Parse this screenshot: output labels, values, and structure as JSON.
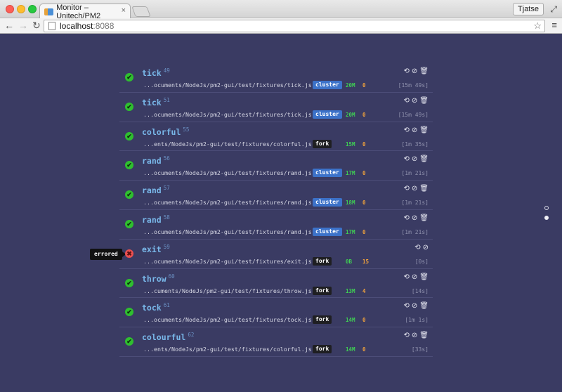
{
  "browser": {
    "tab_title": "Monitor – Unitech/PM2",
    "user": "Tjatse",
    "url_host": "localhost",
    "url_port": ":8088",
    "icons": [
      "back-icon",
      "forward-icon",
      "reload-icon",
      "star-icon",
      "menu-icon",
      "fullscreen-icon"
    ]
  },
  "tooltip": "errored",
  "processes": [
    {
      "name": "tick",
      "pid": "49",
      "script": "...ocuments/NodeJs/pm2-gui/test/fixtures/tick.js",
      "mode": "cluster",
      "memory": "20M",
      "restarts": "0",
      "uptime": "[15m 49s]",
      "status": "online",
      "status_icon": "✔"
    },
    {
      "name": "tick",
      "pid": "51",
      "script": "...ocuments/NodeJs/pm2-gui/test/fixtures/tick.js",
      "mode": "cluster",
      "memory": "20M",
      "restarts": "0",
      "uptime": "[15m 49s]",
      "status": "online",
      "status_icon": "✔"
    },
    {
      "name": "colorful",
      "pid": "55",
      "script": "...ents/NodeJs/pm2-gui/test/fixtures/colorful.js",
      "mode": "fork",
      "memory": "15M",
      "restarts": "0",
      "uptime": "[1m 35s]",
      "status": "online",
      "status_icon": "✔"
    },
    {
      "name": "rand",
      "pid": "56",
      "script": "...ocuments/NodeJs/pm2-gui/test/fixtures/rand.js",
      "mode": "cluster",
      "memory": "17M",
      "restarts": "0",
      "uptime": "[1m 21s]",
      "status": "online",
      "status_icon": "✔"
    },
    {
      "name": "rand",
      "pid": "57",
      "script": "...ocuments/NodeJs/pm2-gui/test/fixtures/rand.js",
      "mode": "cluster",
      "memory": "18M",
      "restarts": "0",
      "uptime": "[1m 21s]",
      "status": "online",
      "status_icon": "✔"
    },
    {
      "name": "rand",
      "pid": "58",
      "script": "...ocuments/NodeJs/pm2-gui/test/fixtures/rand.js",
      "mode": "cluster",
      "memory": "17M",
      "restarts": "0",
      "uptime": "[1m 21s]",
      "status": "online",
      "status_icon": "✔"
    },
    {
      "name": "exit",
      "pid": "59",
      "script": "...ocuments/NodeJs/pm2-gui/test/fixtures/exit.js",
      "mode": "fork",
      "memory": "0B",
      "restarts": "15",
      "uptime": "[0s]",
      "status": "errored",
      "status_icon": "✖"
    },
    {
      "name": "throw",
      "pid": "60",
      "script": "...cuments/NodeJs/pm2-gui/test/fixtures/throw.js",
      "mode": "fork",
      "memory": "13M",
      "restarts": "4",
      "uptime": "[14s]",
      "status": "online",
      "status_icon": "✔"
    },
    {
      "name": "tock",
      "pid": "61",
      "script": "...ocuments/NodeJs/pm2-gui/test/fixtures/tock.js",
      "mode": "fork",
      "memory": "14M",
      "restarts": "0",
      "uptime": "[1m 1s]",
      "status": "online",
      "status_icon": "✔"
    },
    {
      "name": "colourful",
      "pid": "62",
      "script": "...ents/NodeJs/pm2-gui/test/fixtures/colorful.js",
      "mode": "fork",
      "memory": "14M",
      "restarts": "0",
      "uptime": "[33s]",
      "status": "online",
      "status_icon": "✔"
    }
  ],
  "action_icons": {
    "restart": "⟲",
    "stop": "⊘",
    "delete": "🗑"
  },
  "pager": {
    "pages": 2,
    "active": 2
  },
  "colors": {
    "background": "#3a3b63",
    "online": "#2fbf2f",
    "errored": "#ea5050",
    "cluster": "#3c72c9",
    "fork": "#1f1f22",
    "memory": "#3fcf53",
    "restarts": "#f0a23c"
  }
}
